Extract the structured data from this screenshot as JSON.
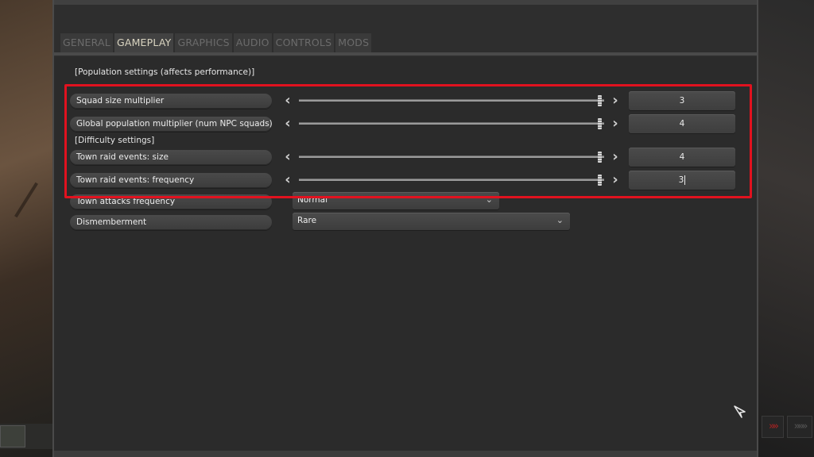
{
  "tabs": [
    "GENERAL",
    "GAMEPLAY",
    "GRAPHICS",
    "AUDIO",
    "CONTROLS",
    "MODS"
  ],
  "active_tab": "GAMEPLAY",
  "sections": {
    "population": "[Population settings (affects performance)]",
    "difficulty": "[Difficulty settings]"
  },
  "sliders": [
    {
      "label": "Squad size multiplier",
      "value": "3",
      "level": 1.0
    },
    {
      "label": "Global population multiplier (num NPC squads)",
      "value": "4",
      "level": 1.0
    },
    {
      "label": "Town raid events: size",
      "value": "4",
      "level": 1.0
    },
    {
      "label": "Town raid events: frequency",
      "value": "3",
      "level": 1.0
    }
  ],
  "dropdowns": [
    {
      "label": "Town attacks frequency",
      "value": "Normal"
    },
    {
      "label": "Dismemberment",
      "value": "Rare"
    }
  ],
  "icons": {
    "left_arrow": "chevron-left-icon",
    "right_arrow": "chevron-right-icon",
    "dropdown": "chevron-down-icon",
    "cursor": "pointer-cursor-icon"
  },
  "colors": {
    "highlight": "#e1121f",
    "active_tab": "#d9d4c0",
    "inactive_tab": "#6b6b6b"
  }
}
